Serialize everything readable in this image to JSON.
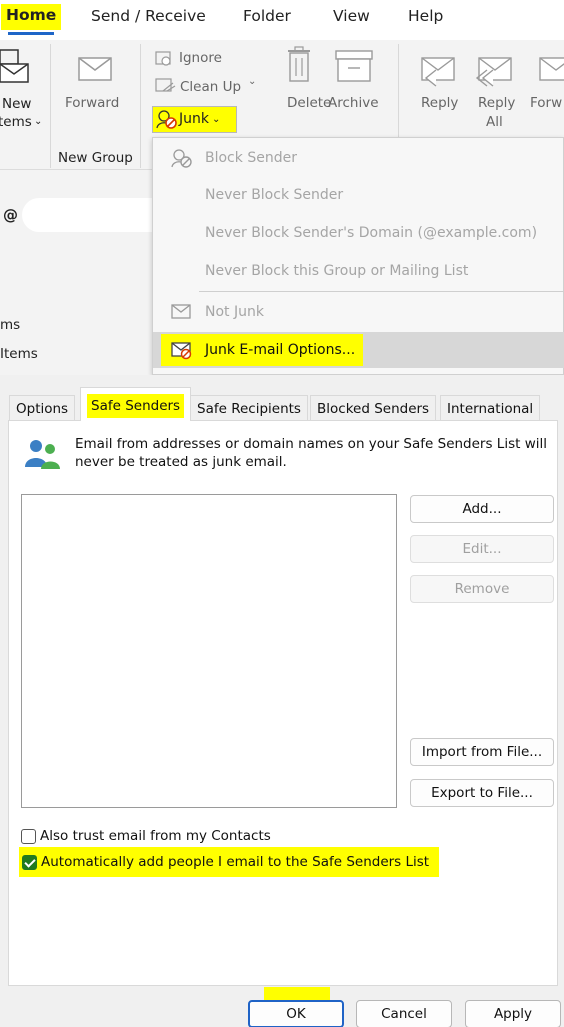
{
  "ribbon": {
    "tabs": [
      "Home",
      "Send / Receive",
      "Folder",
      "View",
      "Help"
    ],
    "new_items": [
      "New",
      "Items"
    ],
    "forward": "Forward",
    "ignore": "Ignore",
    "clean_up": "Clean Up",
    "junk": "Junk",
    "new_group": "New Group",
    "delete": "Delete",
    "archive": "Archive",
    "reply": "Reply",
    "reply_all": [
      "Reply",
      "All"
    ],
    "forward_partial": "Forw"
  },
  "left_nav": {
    "search_prefix": "@",
    "items": [
      "ms",
      "Items"
    ]
  },
  "junk_menu": {
    "items": [
      {
        "label": "Block Sender",
        "icon": "block-sender-icon"
      },
      {
        "label": "Never Block Sender",
        "icon": ""
      },
      {
        "label": "Never Block Sender's Domain (@example.com)",
        "icon": ""
      },
      {
        "label": "Never Block this Group or Mailing List",
        "icon": ""
      },
      {
        "label": "Not Junk",
        "icon": "envelope-icon"
      },
      {
        "label": "Junk E-mail Options...",
        "icon": "junk-options-icon"
      }
    ]
  },
  "dialog": {
    "tabs": [
      "Options",
      "Safe Senders",
      "Safe Recipients",
      "Blocked Senders",
      "International"
    ],
    "active_tab": "Safe Senders",
    "description": "Email from addresses or domain names on your Safe Senders List will never be treated as junk email.",
    "buttons": {
      "add": "Add...",
      "edit": "Edit...",
      "remove": "Remove",
      "import": "Import from File...",
      "export": "Export to File..."
    },
    "checkboxes": {
      "trust_contacts": {
        "label": "Also trust email from my Contacts",
        "checked": false
      },
      "auto_add": {
        "label": "Automatically add people I email to the Safe Senders List",
        "checked": true
      }
    },
    "footer": {
      "ok": "OK",
      "cancel": "Cancel",
      "apply": "Apply"
    }
  },
  "colors": {
    "highlight": "#ffff00",
    "accent_blue": "#1f63c6",
    "check_green": "#217a1f"
  }
}
